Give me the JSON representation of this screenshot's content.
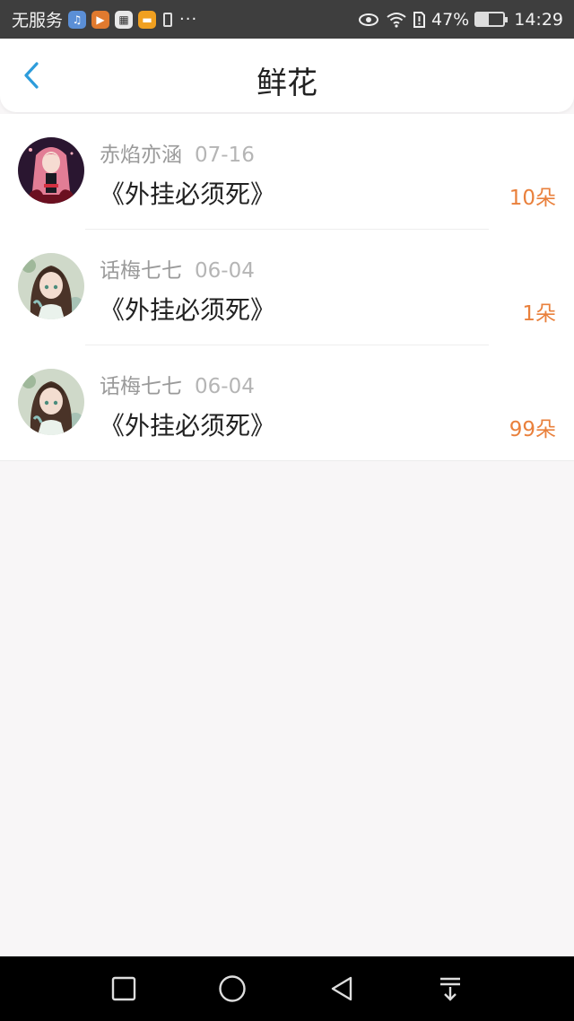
{
  "status_bar": {
    "carrier": "无服务",
    "battery_percent": "47%",
    "battery_level": 0.47,
    "time": "14:29",
    "more": "···",
    "icons": [
      "music-app-icon",
      "video-app-icon",
      "calendar-app-icon",
      "alipay-app-icon",
      "battery-saver-icon",
      "eye-icon",
      "wifi-icon",
      "sim-icon",
      "battery-icon"
    ]
  },
  "header": {
    "title": "鲜花",
    "back_icon": "chevron-left-icon",
    "accent_color": "#2d9cdb"
  },
  "items": [
    {
      "user": "赤焰亦涵",
      "date": "07-16",
      "book": "《外挂必须死》",
      "count": "10朵",
      "avatar": "red-hair-anime-girl"
    },
    {
      "user": "话梅七七",
      "date": "06-04",
      "book": "《外挂必须死》",
      "count": "1朵",
      "avatar": "brown-hair-anime-girl"
    },
    {
      "user": "话梅七七",
      "date": "06-04",
      "book": "《外挂必须死》",
      "count": "99朵",
      "avatar": "brown-hair-anime-girl"
    }
  ],
  "count_color": "#e9803c",
  "nav_bar": {
    "buttons": [
      "square-icon",
      "circle-icon",
      "triangle-back-icon",
      "notification-down-icon"
    ]
  }
}
